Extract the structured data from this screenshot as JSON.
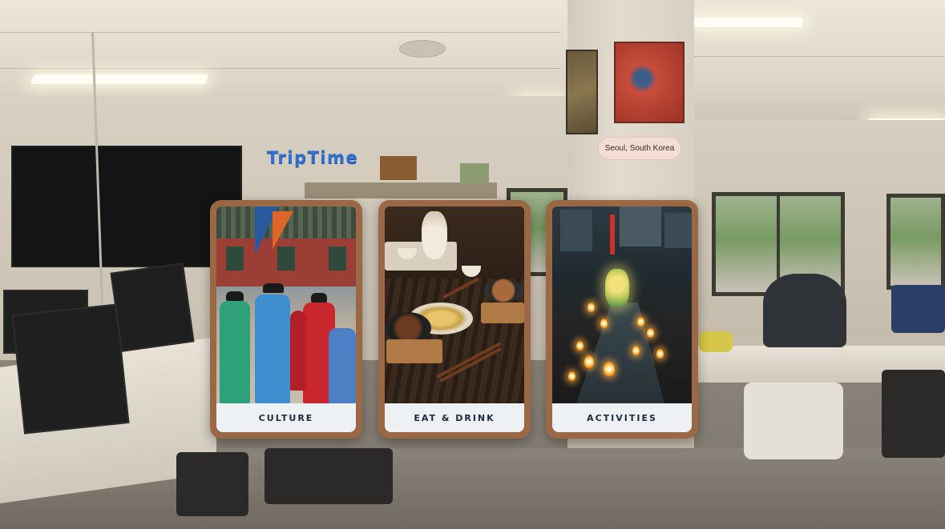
{
  "app": {
    "brand": "TripTime",
    "location": "Seoul, South Korea"
  },
  "categories": [
    {
      "label": "CULTURE",
      "image_icon": "palace-guards-photo"
    },
    {
      "label": "EAT & DRINK",
      "image_icon": "korean-food-photo"
    },
    {
      "label": "ACTIVITIES",
      "image_icon": "lantern-festival-photo"
    }
  ],
  "colors": {
    "brand": "#2f6fd0",
    "card_frame": "#9b6846",
    "card_label_bg": "#eef1f4",
    "card_label_text": "#1d2b3f",
    "location_chip": "#f4dcd7"
  }
}
